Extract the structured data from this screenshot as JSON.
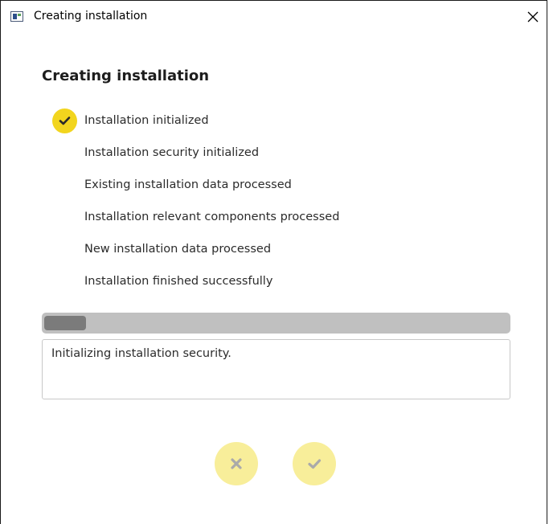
{
  "window": {
    "title": "Creating installation"
  },
  "page": {
    "heading": "Creating installation"
  },
  "steps": [
    {
      "label": "Installation initialized",
      "completed": true
    },
    {
      "label": "Installation security initialized",
      "completed": false
    },
    {
      "label": "Existing installation data processed",
      "completed": false
    },
    {
      "label": "Installation relevant components processed",
      "completed": false
    },
    {
      "label": "New installation data processed",
      "completed": false
    },
    {
      "label": "Installation finished successfully",
      "completed": false
    }
  ],
  "progress": {
    "percent": 9
  },
  "status": {
    "message": "Initializing installation security."
  },
  "buttons": {
    "cancel_icon": "x-icon",
    "confirm_icon": "checkmark-icon"
  },
  "colors": {
    "accent": "#f2d51e",
    "accent_light": "#f8ee9a",
    "progress_track": "#c0c0c0",
    "progress_fill": "#7b7b7b"
  }
}
